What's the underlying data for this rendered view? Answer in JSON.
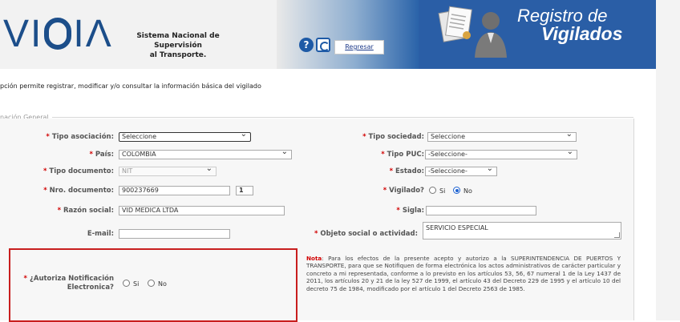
{
  "header": {
    "logo_text_left": "VI",
    "logo_text_right": "IΛ",
    "system_name_line1": "Sistema Nacional de Supervisión",
    "system_name_line2": "al Transporte.",
    "help_symbol": "?",
    "back_link": "Regresar",
    "title_line1": "Registro de",
    "title_line2": "Vigilados",
    "icons": [
      "vigia-logo",
      "help-icon",
      "back-icon",
      "documents-icon",
      "person-icon"
    ],
    "colors": {
      "brand_blue": "#2a5ea6",
      "logo_blue": "#1c4e8a"
    }
  },
  "intro_text": "pción permite registrar, modificar y/o consultar la información básica del vigilado",
  "section_legend": "nación General",
  "form": {
    "tipo_asociacion": {
      "label": "Tipo asociación:",
      "value": "Seleccione"
    },
    "tipo_sociedad": {
      "label": "Tipo sociedad:",
      "value": "Seleccione"
    },
    "pais": {
      "label": "País:",
      "value": "COLOMBIA"
    },
    "tipo_puc": {
      "label": "Tipo PUC:",
      "value": "-Seleccione-"
    },
    "tipo_documento": {
      "label": "Tipo documento:",
      "value": "NIT"
    },
    "estado": {
      "label": "Estado:",
      "value": "-Seleccione-"
    },
    "nro_documento": {
      "label": "Nro. documento:",
      "value": "900237669",
      "dv": "1"
    },
    "vigilado": {
      "label": "Vigilado?",
      "options": [
        "Si",
        "No"
      ],
      "selected": "No"
    },
    "razon_social": {
      "label": "Razón social:",
      "value": "VID MEDICA LTDA"
    },
    "sigla": {
      "label": "Sigla:",
      "value": ""
    },
    "email": {
      "label": "E-mail:",
      "value": ""
    },
    "objeto_social": {
      "label": "Objeto social o actividad:",
      "value": "SERVICIO ESPECIAL"
    },
    "autoriza_notificacion": {
      "label_line1": "¿Autoriza Notificación",
      "label_line2": "Electronica?",
      "options": [
        "Si",
        "No"
      ],
      "selected": ""
    },
    "required_mark": "*"
  },
  "note": {
    "title": "Nota",
    "text": ": Para los efectos de la presente acepto y autorizo a la SUPERINTENDENCIA DE PUERTOS Y TRANSPORTE, para que se Notifiquen de forma electrónica los actos administrativos de carácter particular y concreto a mi representada, conforme a lo previsto en los artículos 53, 56, 67 numeral 1 de la Ley 1437 de 2011, los artículos 20 y 21 de la ley 527 de 1999, el artículo 43 del Decreto 229 de 1995 y el artículo 10 del decreto 75 de 1984, modificado por el artículo 1 del Decreto 2563 de 1985."
  }
}
